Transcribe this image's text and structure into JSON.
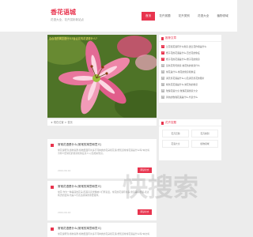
{
  "site": {
    "title": "香花语城",
    "subtitle": "花语大全、花卉赏析新站点"
  },
  "nav": {
    "items": [
      "首页",
      "花卉赏题",
      "花卉类别",
      "花语大全",
      "植物领域"
    ]
  },
  "hero": {
    "caption": "百合花的寓意是什么?百合花的花语是什么?"
  },
  "breadcrumb": "★ 现在位置 > 首页",
  "posts": [
    {
      "title": "常常花语是什么(常常的寓意和意义)",
      "excerpt": "常花说明到,植物喜群.植物里面有许多不同种类的花朵和花语,想知道常常花语是什么吗?本文将为你介绍常花的寓意和象征意义,以及相关知识。",
      "date": "2024-09-16",
      "more": "阅读全文"
    },
    {
      "title": "常常花语是什么(常常的寓意和意义)",
      "excerpt": "常花,作为一种美丽的花朵,因其高贵优雅被人们所喜爱。常花的花语有许多,寓意美好祝福,表达纯洁的爱情,也是人们表达感情的重要载体。",
      "date": "2024-09-16",
      "more": "阅读全文"
    },
    {
      "title": "常常花语是什么(常常的寓意和意义)",
      "excerpt": "常花说明到,植物喜群.植物里面有许多不同种类的花朵和花语,想知道常常花语是什么吗?本文将为你介绍常花的寓意。",
      "date": "2024-09-16",
      "more": "阅读全文"
    }
  ],
  "ranking": {
    "title": "推荐文章",
    "items": [
      "兰花和花语有什么寓意,送兰花作用是什么",
      "橙子花的花语是什么,百合花的象征",
      "橙子花的花语是什么,橙子花的寓意",
      "蓝色花有何寓意,常花色的寓意什么",
      "常花是什么,常花的寓意和象征",
      "满天星花语是什么,以及满天星花的图片",
      "紫色花花语是什么,常花色的寓意",
      "玫瑰花语大全,玫瑰花语寓意大全",
      "黄色的玫瑰花语是什么,代表什么"
    ]
  },
  "categories": {
    "title": "花卉赏题",
    "items": [
      "花卉赏题",
      "花卉类别",
      "花语大全",
      "植物领域"
    ]
  },
  "watermark": "快搜索",
  "colors": {
    "brand": "#e8344e",
    "background": "#ececec",
    "panel": "#ffffff"
  }
}
